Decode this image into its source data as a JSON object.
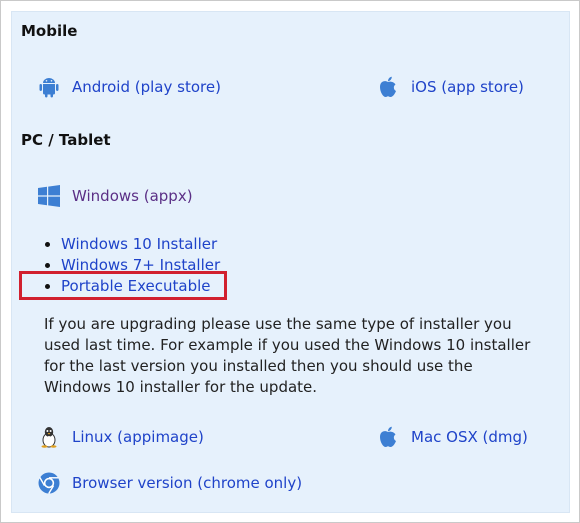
{
  "mobile": {
    "heading": "Mobile",
    "android_label": "Android (play store)",
    "ios_label": "iOS (app store)"
  },
  "pc": {
    "heading": "PC / Tablet",
    "windows_label": "Windows (appx)",
    "installer_links": [
      "Windows 10 Installer",
      "Windows 7+ Installer",
      "Portable Executable"
    ],
    "note": "If you are upgrading please use the same type of installer you used last time. For example if you used the Windows 10 installer for the last version you installed then you should use the Windows 10 installer for the update.",
    "linux_label": "Linux (appimage)",
    "mac_label": "Mac OSX (dmg)",
    "browser_label": "Browser version (chrome only)"
  },
  "colors": {
    "panel_bg": "#e6f1fc",
    "link": "#1f43c9",
    "visited_link": "#5b2f86",
    "highlight_box": "#d1202f",
    "icon_blue": "#3d7fd3"
  },
  "icons": [
    "android-icon",
    "apple-icon",
    "windows-icon",
    "linux-icon",
    "chrome-icon"
  ]
}
